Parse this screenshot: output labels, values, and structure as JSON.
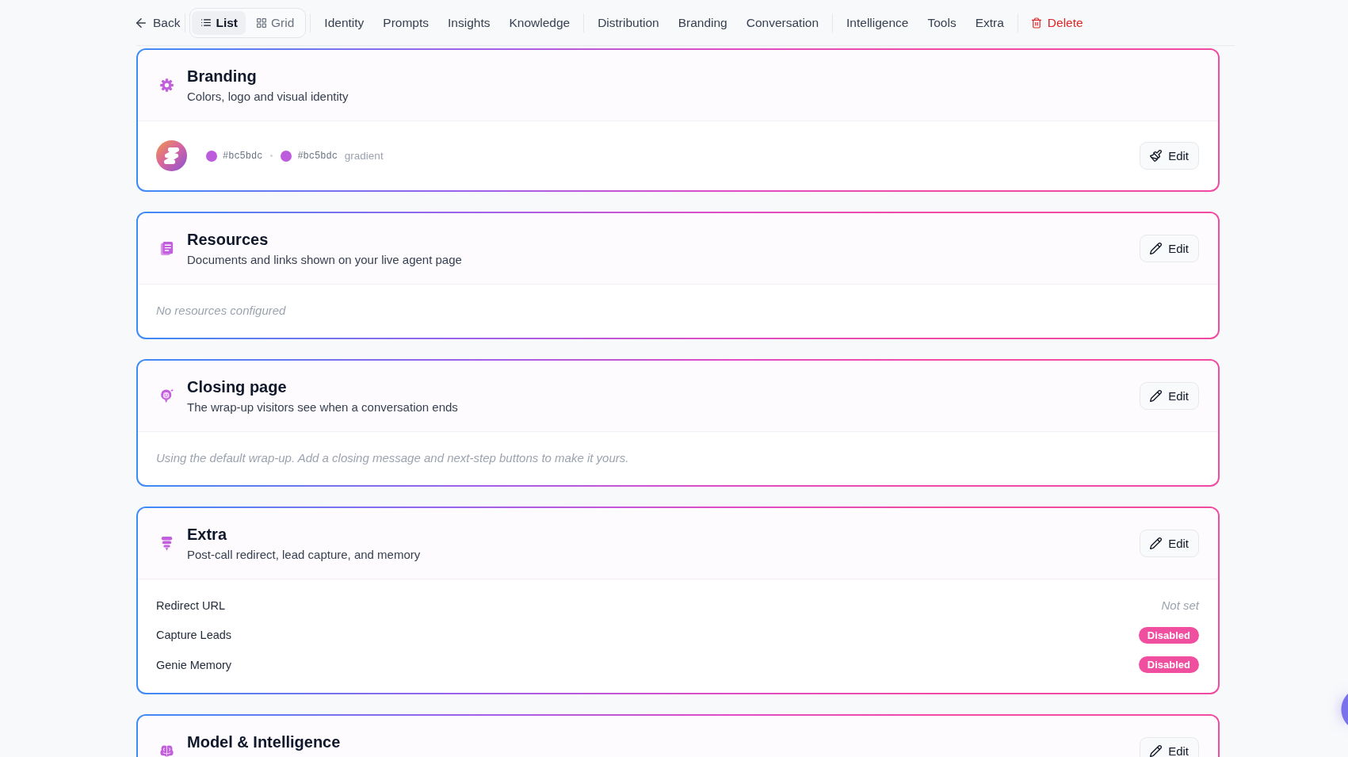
{
  "nav": {
    "back": "Back",
    "view_toggle": [
      {
        "label": "List",
        "selected": true
      },
      {
        "label": "Grid",
        "selected": false
      }
    ],
    "section_groups": [
      [
        "Identity",
        "Prompts",
        "Insights",
        "Knowledge"
      ],
      [
        "Distribution",
        "Branding",
        "Conversation"
      ],
      [
        "Intelligence",
        "Tools",
        "Extra"
      ]
    ],
    "delete": "Delete"
  },
  "cards": [
    {
      "kind": "branding",
      "title": "Branding",
      "subtitle": "Colors, logo and visual identity",
      "swatches": [
        {
          "label": "#bc5bdc",
          "color": "#bc5bdc"
        },
        {
          "label": "#bc5bdc",
          "color": "#bc5bdc"
        }
      ],
      "style_label": "gradient",
      "edit": "Edit"
    },
    {
      "kind": "note",
      "title": "Resources",
      "subtitle": "Documents and links shown on your live agent page",
      "note": "No resources configured",
      "edit": "Edit"
    },
    {
      "kind": "note",
      "title": "Closing page",
      "subtitle": "The wrap-up visitors see when a conversation ends",
      "note": "Using the default wrap-up. Add a closing message and next-step buttons to make it yours.",
      "edit": "Edit"
    },
    {
      "kind": "settings",
      "title": "Extra",
      "subtitle": "Post-call redirect, lead capture, and memory",
      "rows": [
        {
          "label": "Redirect URL",
          "value": "Not set",
          "kind": "empty"
        },
        {
          "label": "Capture Leads",
          "value": "Disabled",
          "kind": "badge"
        },
        {
          "label": "Genie Memory",
          "value": "Disabled",
          "kind": "badge"
        }
      ],
      "edit": "Edit"
    },
    {
      "kind": "section",
      "title": "Model & Intelligence",
      "edit": "Edit"
    }
  ]
}
